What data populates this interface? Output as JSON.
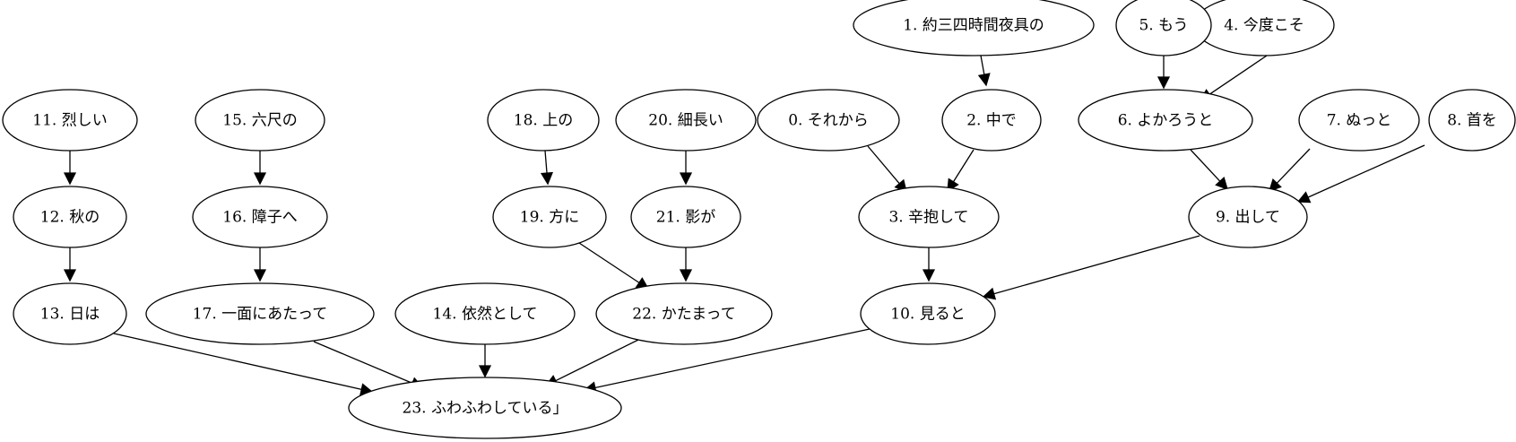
{
  "diagram": {
    "nodes": [
      {
        "id": "n0",
        "label": "0. それから"
      },
      {
        "id": "n1",
        "label": "1. 約三四時間夜具の"
      },
      {
        "id": "n2",
        "label": "2. 中で"
      },
      {
        "id": "n3",
        "label": "3. 辛抱して"
      },
      {
        "id": "n4",
        "label": "4. 今度こそ"
      },
      {
        "id": "n5",
        "label": "5. もう"
      },
      {
        "id": "n6",
        "label": "6. よかろうと"
      },
      {
        "id": "n7",
        "label": "7. ぬっと"
      },
      {
        "id": "n8",
        "label": "8. 首を"
      },
      {
        "id": "n9",
        "label": "9. 出して"
      },
      {
        "id": "n10",
        "label": "10. 見ると"
      },
      {
        "id": "n11",
        "label": "11. 烈しい"
      },
      {
        "id": "n12",
        "label": "12. 秋の"
      },
      {
        "id": "n13",
        "label": "13. 日は"
      },
      {
        "id": "n14",
        "label": "14. 依然として"
      },
      {
        "id": "n15",
        "label": "15. 六尺の"
      },
      {
        "id": "n16",
        "label": "16. 障子へ"
      },
      {
        "id": "n17",
        "label": "17. 一面にあたって"
      },
      {
        "id": "n18",
        "label": "18. 上の"
      },
      {
        "id": "n19",
        "label": "19. 方に"
      },
      {
        "id": "n20",
        "label": "20. 細長い"
      },
      {
        "id": "n21",
        "label": "21. 影が"
      },
      {
        "id": "n22",
        "label": "22. かたまって"
      },
      {
        "id": "n23",
        "label": "23. ふわふわしている」"
      }
    ],
    "edges": [
      {
        "from": "n1",
        "to": "n2"
      },
      {
        "from": "n0",
        "to": "n3"
      },
      {
        "from": "n2",
        "to": "n3"
      },
      {
        "from": "n5",
        "to": "n6"
      },
      {
        "from": "n4",
        "to": "n6"
      },
      {
        "from": "n6",
        "to": "n9"
      },
      {
        "from": "n7",
        "to": "n9"
      },
      {
        "from": "n8",
        "to": "n9"
      },
      {
        "from": "n3",
        "to": "n10"
      },
      {
        "from": "n9",
        "to": "n10"
      },
      {
        "from": "n11",
        "to": "n12"
      },
      {
        "from": "n12",
        "to": "n13"
      },
      {
        "from": "n15",
        "to": "n16"
      },
      {
        "from": "n16",
        "to": "n17"
      },
      {
        "from": "n18",
        "to": "n19"
      },
      {
        "from": "n20",
        "to": "n21"
      },
      {
        "from": "n19",
        "to": "n22"
      },
      {
        "from": "n21",
        "to": "n22"
      },
      {
        "from": "n13",
        "to": "n23"
      },
      {
        "from": "n17",
        "to": "n23"
      },
      {
        "from": "n14",
        "to": "n23"
      },
      {
        "from": "n22",
        "to": "n23"
      },
      {
        "from": "n10",
        "to": "n23"
      }
    ]
  }
}
